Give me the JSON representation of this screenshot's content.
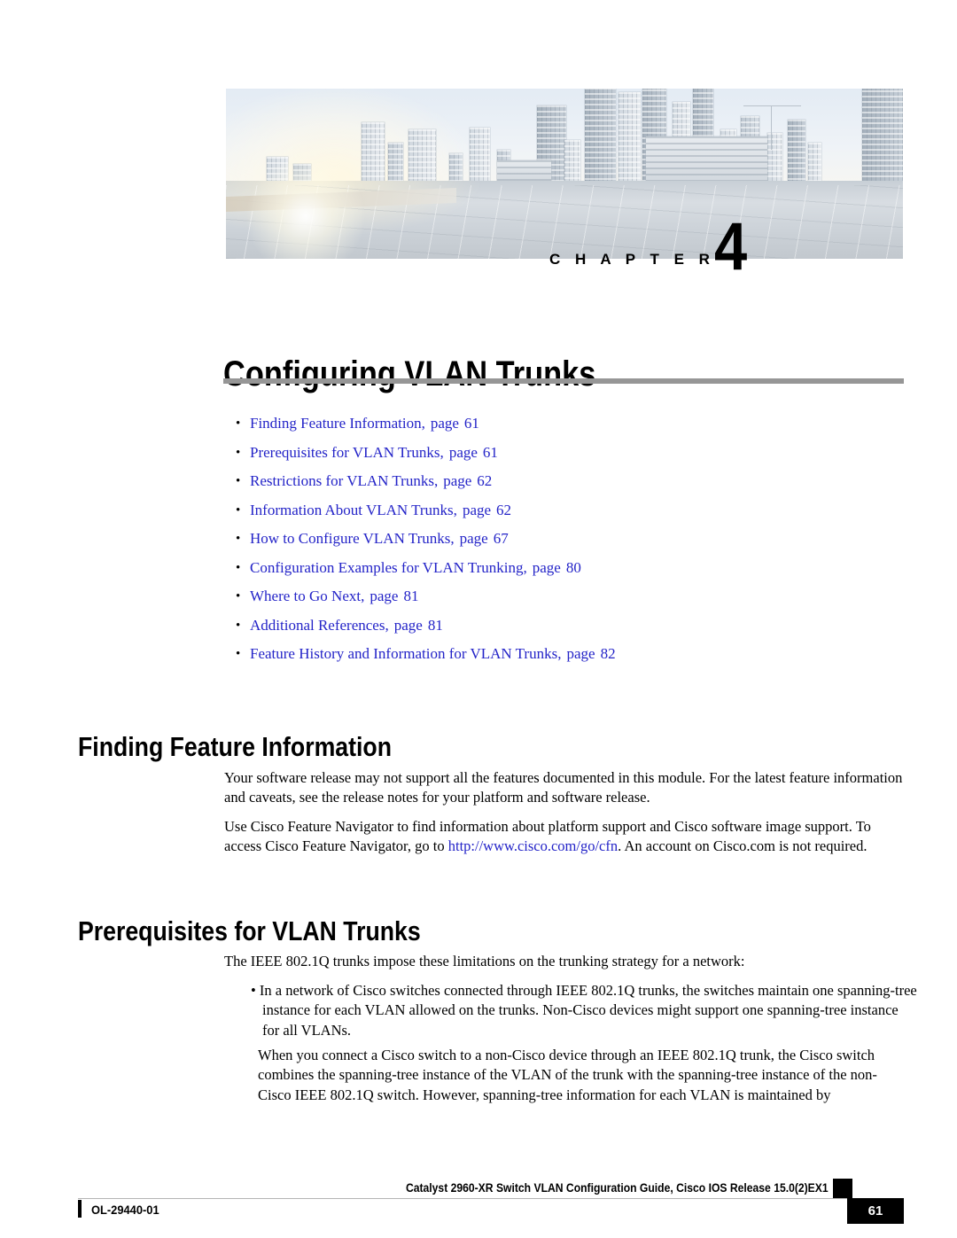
{
  "banner": {
    "chapter_label": "C H A P T E R",
    "chapter_number": "4"
  },
  "chapter": {
    "title": "Configuring VLAN Trunks"
  },
  "toc": {
    "bullet": "•",
    "items": [
      {
        "title": "Finding Feature Information,",
        "page_label": "page",
        "page": "61"
      },
      {
        "title": "Prerequisites for VLAN Trunks,",
        "page_label": "page",
        "page": "61"
      },
      {
        "title": "Restrictions for VLAN Trunks,",
        "page_label": "page",
        "page": "62"
      },
      {
        "title": "Information About VLAN Trunks,",
        "page_label": "page",
        "page": "62"
      },
      {
        "title": "How to Configure VLAN Trunks,",
        "page_label": "page",
        "page": "67"
      },
      {
        "title": "Configuration Examples for VLAN Trunking,",
        "page_label": "page",
        "page": "80"
      },
      {
        "title": "Where to Go Next,",
        "page_label": "page",
        "page": "81"
      },
      {
        "title": "Additional References,",
        "page_label": "page",
        "page": "81"
      },
      {
        "title": "Feature History and Information for VLAN Trunks,",
        "page_label": "page",
        "page": "82"
      }
    ]
  },
  "sections": {
    "finding": {
      "heading": "Finding Feature Information",
      "paragraph_1": "Your software release may not support all the features documented in this module. For the latest feature information and caveats, see the release notes for your platform and software release.",
      "paragraph_2_before": "Use Cisco Feature Navigator to find information about platform support and Cisco software image support. To access Cisco Feature Navigator, go to ",
      "paragraph_2_link": "http://www.cisco.com/go/cfn",
      "paragraph_2_after": ". An account on Cisco.com is not required."
    },
    "prerequisites": {
      "heading": "Prerequisites for VLAN Trunks",
      "intro": "The IEEE 802.1Q trunks impose these limitations on the trunking strategy for a network:",
      "bullet_item": "• In a network of Cisco switches connected through IEEE 802.1Q trunks, the switches maintain one spanning-tree instance for each VLAN allowed on the trunks. Non-Cisco devices might support one spanning-tree instance for all VLANs.",
      "paragraph": "When you connect a Cisco switch to a non-Cisco device through an IEEE 802.1Q trunk, the Cisco switch combines the spanning-tree instance of the VLAN of the trunk with the spanning-tree instance of the non-Cisco IEEE 802.1Q switch. However, spanning-tree information for each VLAN is maintained by"
    }
  },
  "footer": {
    "document_id": "OL-29440-01",
    "document_title": "Catalyst 2960-XR Switch VLAN Configuration Guide, Cisco IOS Release 15.0(2)EX1",
    "page_number": "61"
  },
  "colors": {
    "link_blue": "#2424c8",
    "rule_gray": "#969696",
    "black": "#000000"
  }
}
